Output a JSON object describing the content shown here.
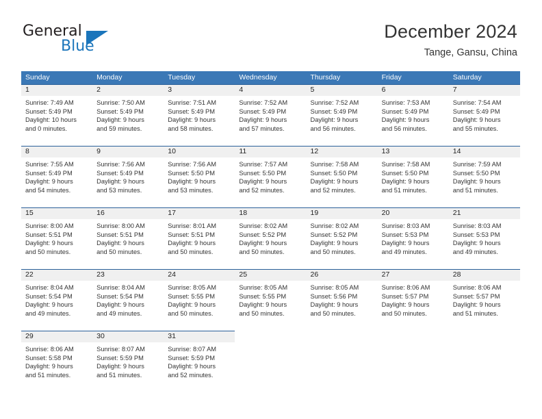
{
  "brand": {
    "name_part1": "General",
    "name_part2": "Blue",
    "logo_icon": "triangle-logo-icon"
  },
  "header": {
    "title": "December 2024",
    "location": "Tange, Gansu, China"
  },
  "theme": {
    "header_blue": "#3b78b6",
    "divider_blue": "#2a6099",
    "daynum_band": "#f0f0f0",
    "brand_blue": "#1b75bb",
    "text": "#333333"
  },
  "weekdays": [
    "Sunday",
    "Monday",
    "Tuesday",
    "Wednesday",
    "Thursday",
    "Friday",
    "Saturday"
  ],
  "weeks": [
    [
      {
        "day": "1",
        "sunrise": "Sunrise: 7:49 AM",
        "sunset": "Sunset: 5:49 PM",
        "daylight1": "Daylight: 10 hours",
        "daylight2": "and 0 minutes."
      },
      {
        "day": "2",
        "sunrise": "Sunrise: 7:50 AM",
        "sunset": "Sunset: 5:49 PM",
        "daylight1": "Daylight: 9 hours",
        "daylight2": "and 59 minutes."
      },
      {
        "day": "3",
        "sunrise": "Sunrise: 7:51 AM",
        "sunset": "Sunset: 5:49 PM",
        "daylight1": "Daylight: 9 hours",
        "daylight2": "and 58 minutes."
      },
      {
        "day": "4",
        "sunrise": "Sunrise: 7:52 AM",
        "sunset": "Sunset: 5:49 PM",
        "daylight1": "Daylight: 9 hours",
        "daylight2": "and 57 minutes."
      },
      {
        "day": "5",
        "sunrise": "Sunrise: 7:52 AM",
        "sunset": "Sunset: 5:49 PM",
        "daylight1": "Daylight: 9 hours",
        "daylight2": "and 56 minutes."
      },
      {
        "day": "6",
        "sunrise": "Sunrise: 7:53 AM",
        "sunset": "Sunset: 5:49 PM",
        "daylight1": "Daylight: 9 hours",
        "daylight2": "and 56 minutes."
      },
      {
        "day": "7",
        "sunrise": "Sunrise: 7:54 AM",
        "sunset": "Sunset: 5:49 PM",
        "daylight1": "Daylight: 9 hours",
        "daylight2": "and 55 minutes."
      }
    ],
    [
      {
        "day": "8",
        "sunrise": "Sunrise: 7:55 AM",
        "sunset": "Sunset: 5:49 PM",
        "daylight1": "Daylight: 9 hours",
        "daylight2": "and 54 minutes."
      },
      {
        "day": "9",
        "sunrise": "Sunrise: 7:56 AM",
        "sunset": "Sunset: 5:49 PM",
        "daylight1": "Daylight: 9 hours",
        "daylight2": "and 53 minutes."
      },
      {
        "day": "10",
        "sunrise": "Sunrise: 7:56 AM",
        "sunset": "Sunset: 5:50 PM",
        "daylight1": "Daylight: 9 hours",
        "daylight2": "and 53 minutes."
      },
      {
        "day": "11",
        "sunrise": "Sunrise: 7:57 AM",
        "sunset": "Sunset: 5:50 PM",
        "daylight1": "Daylight: 9 hours",
        "daylight2": "and 52 minutes."
      },
      {
        "day": "12",
        "sunrise": "Sunrise: 7:58 AM",
        "sunset": "Sunset: 5:50 PM",
        "daylight1": "Daylight: 9 hours",
        "daylight2": "and 52 minutes."
      },
      {
        "day": "13",
        "sunrise": "Sunrise: 7:58 AM",
        "sunset": "Sunset: 5:50 PM",
        "daylight1": "Daylight: 9 hours",
        "daylight2": "and 51 minutes."
      },
      {
        "day": "14",
        "sunrise": "Sunrise: 7:59 AM",
        "sunset": "Sunset: 5:50 PM",
        "daylight1": "Daylight: 9 hours",
        "daylight2": "and 51 minutes."
      }
    ],
    [
      {
        "day": "15",
        "sunrise": "Sunrise: 8:00 AM",
        "sunset": "Sunset: 5:51 PM",
        "daylight1": "Daylight: 9 hours",
        "daylight2": "and 50 minutes."
      },
      {
        "day": "16",
        "sunrise": "Sunrise: 8:00 AM",
        "sunset": "Sunset: 5:51 PM",
        "daylight1": "Daylight: 9 hours",
        "daylight2": "and 50 minutes."
      },
      {
        "day": "17",
        "sunrise": "Sunrise: 8:01 AM",
        "sunset": "Sunset: 5:51 PM",
        "daylight1": "Daylight: 9 hours",
        "daylight2": "and 50 minutes."
      },
      {
        "day": "18",
        "sunrise": "Sunrise: 8:02 AM",
        "sunset": "Sunset: 5:52 PM",
        "daylight1": "Daylight: 9 hours",
        "daylight2": "and 50 minutes."
      },
      {
        "day": "19",
        "sunrise": "Sunrise: 8:02 AM",
        "sunset": "Sunset: 5:52 PM",
        "daylight1": "Daylight: 9 hours",
        "daylight2": "and 50 minutes."
      },
      {
        "day": "20",
        "sunrise": "Sunrise: 8:03 AM",
        "sunset": "Sunset: 5:53 PM",
        "daylight1": "Daylight: 9 hours",
        "daylight2": "and 49 minutes."
      },
      {
        "day": "21",
        "sunrise": "Sunrise: 8:03 AM",
        "sunset": "Sunset: 5:53 PM",
        "daylight1": "Daylight: 9 hours",
        "daylight2": "and 49 minutes."
      }
    ],
    [
      {
        "day": "22",
        "sunrise": "Sunrise: 8:04 AM",
        "sunset": "Sunset: 5:54 PM",
        "daylight1": "Daylight: 9 hours",
        "daylight2": "and 49 minutes."
      },
      {
        "day": "23",
        "sunrise": "Sunrise: 8:04 AM",
        "sunset": "Sunset: 5:54 PM",
        "daylight1": "Daylight: 9 hours",
        "daylight2": "and 49 minutes."
      },
      {
        "day": "24",
        "sunrise": "Sunrise: 8:05 AM",
        "sunset": "Sunset: 5:55 PM",
        "daylight1": "Daylight: 9 hours",
        "daylight2": "and 50 minutes."
      },
      {
        "day": "25",
        "sunrise": "Sunrise: 8:05 AM",
        "sunset": "Sunset: 5:55 PM",
        "daylight1": "Daylight: 9 hours",
        "daylight2": "and 50 minutes."
      },
      {
        "day": "26",
        "sunrise": "Sunrise: 8:05 AM",
        "sunset": "Sunset: 5:56 PM",
        "daylight1": "Daylight: 9 hours",
        "daylight2": "and 50 minutes."
      },
      {
        "day": "27",
        "sunrise": "Sunrise: 8:06 AM",
        "sunset": "Sunset: 5:57 PM",
        "daylight1": "Daylight: 9 hours",
        "daylight2": "and 50 minutes."
      },
      {
        "day": "28",
        "sunrise": "Sunrise: 8:06 AM",
        "sunset": "Sunset: 5:57 PM",
        "daylight1": "Daylight: 9 hours",
        "daylight2": "and 51 minutes."
      }
    ],
    [
      {
        "day": "29",
        "sunrise": "Sunrise: 8:06 AM",
        "sunset": "Sunset: 5:58 PM",
        "daylight1": "Daylight: 9 hours",
        "daylight2": "and 51 minutes."
      },
      {
        "day": "30",
        "sunrise": "Sunrise: 8:07 AM",
        "sunset": "Sunset: 5:59 PM",
        "daylight1": "Daylight: 9 hours",
        "daylight2": "and 51 minutes."
      },
      {
        "day": "31",
        "sunrise": "Sunrise: 8:07 AM",
        "sunset": "Sunset: 5:59 PM",
        "daylight1": "Daylight: 9 hours",
        "daylight2": "and 52 minutes."
      },
      {
        "day": "",
        "sunrise": "",
        "sunset": "",
        "daylight1": "",
        "daylight2": ""
      },
      {
        "day": "",
        "sunrise": "",
        "sunset": "",
        "daylight1": "",
        "daylight2": ""
      },
      {
        "day": "",
        "sunrise": "",
        "sunset": "",
        "daylight1": "",
        "daylight2": ""
      },
      {
        "day": "",
        "sunrise": "",
        "sunset": "",
        "daylight1": "",
        "daylight2": ""
      }
    ]
  ]
}
